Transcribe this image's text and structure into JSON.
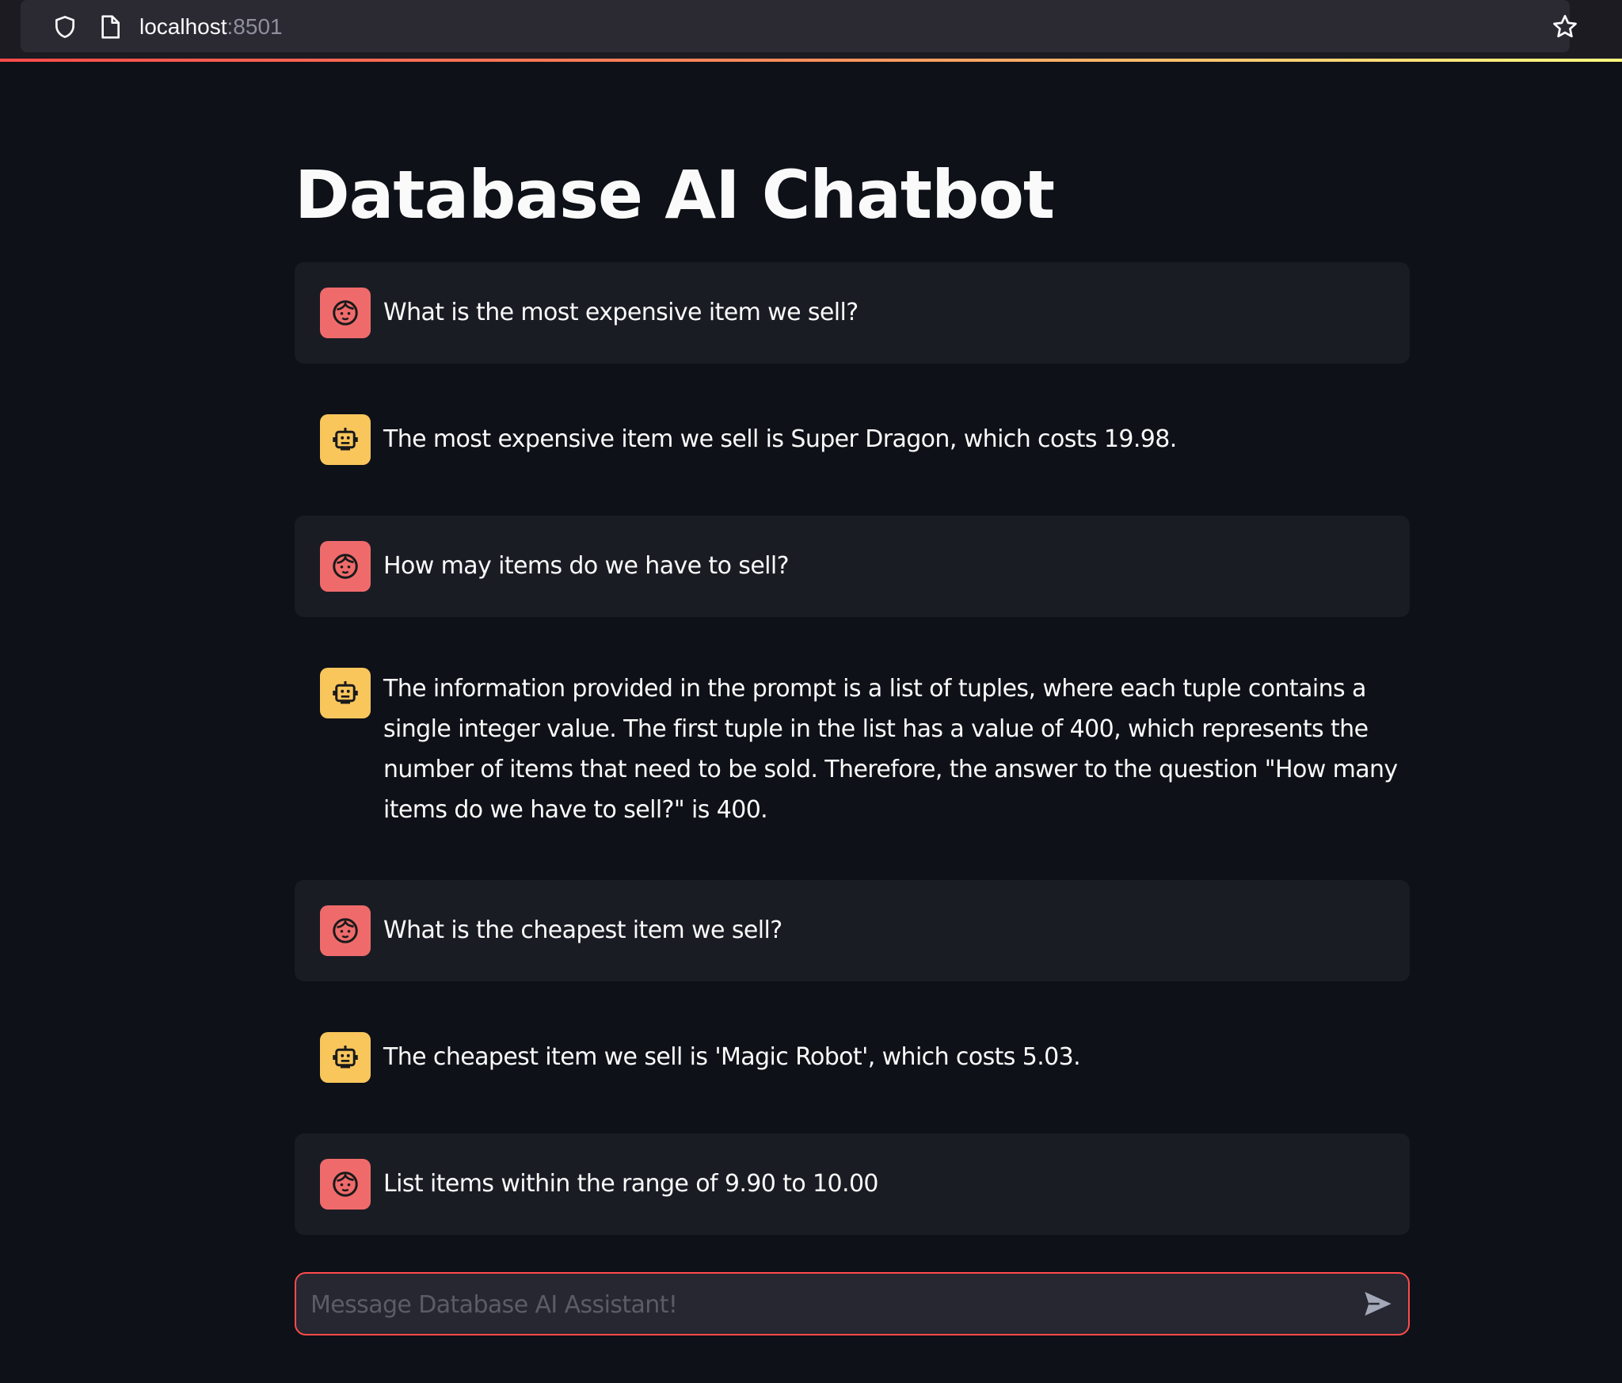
{
  "browser": {
    "url_host": "localhost",
    "url_port": ":8501"
  },
  "page": {
    "title": "Database AI Chatbot"
  },
  "messages": [
    {
      "role": "user",
      "text": "What is the most expensive item we sell?"
    },
    {
      "role": "assistant",
      "text": "The most expensive item we sell is Super Dragon, which costs 19.98."
    },
    {
      "role": "user",
      "text": "How may items do we have to sell?"
    },
    {
      "role": "assistant",
      "text": "The information provided in the prompt is a list of tuples, where each tuple contains a single integer value. The first tuple in the list has a value of 400, which represents the number of items that need to be sold. Therefore, the answer to the question \"How many items do we have to sell?\" is 400."
    },
    {
      "role": "user",
      "text": "What is the cheapest item we sell?"
    },
    {
      "role": "assistant",
      "text": "The cheapest item we sell is 'Magic Robot', which costs 5.03."
    },
    {
      "role": "user",
      "text": "List items within the range of 9.90 to 10.00"
    }
  ],
  "chat_input": {
    "value": "",
    "placeholder": "Message Database AI Assistant!"
  },
  "icons": {
    "user_avatar": "user-face-icon",
    "assistant_avatar": "robot-icon",
    "send": "send-arrow-icon"
  },
  "colors": {
    "background": "#0e1117",
    "user_bubble": "#1a1c24",
    "user_avatar": "#ef6b6b",
    "assistant_avatar": "#f9c65c",
    "accent": "#ff4b4b"
  }
}
